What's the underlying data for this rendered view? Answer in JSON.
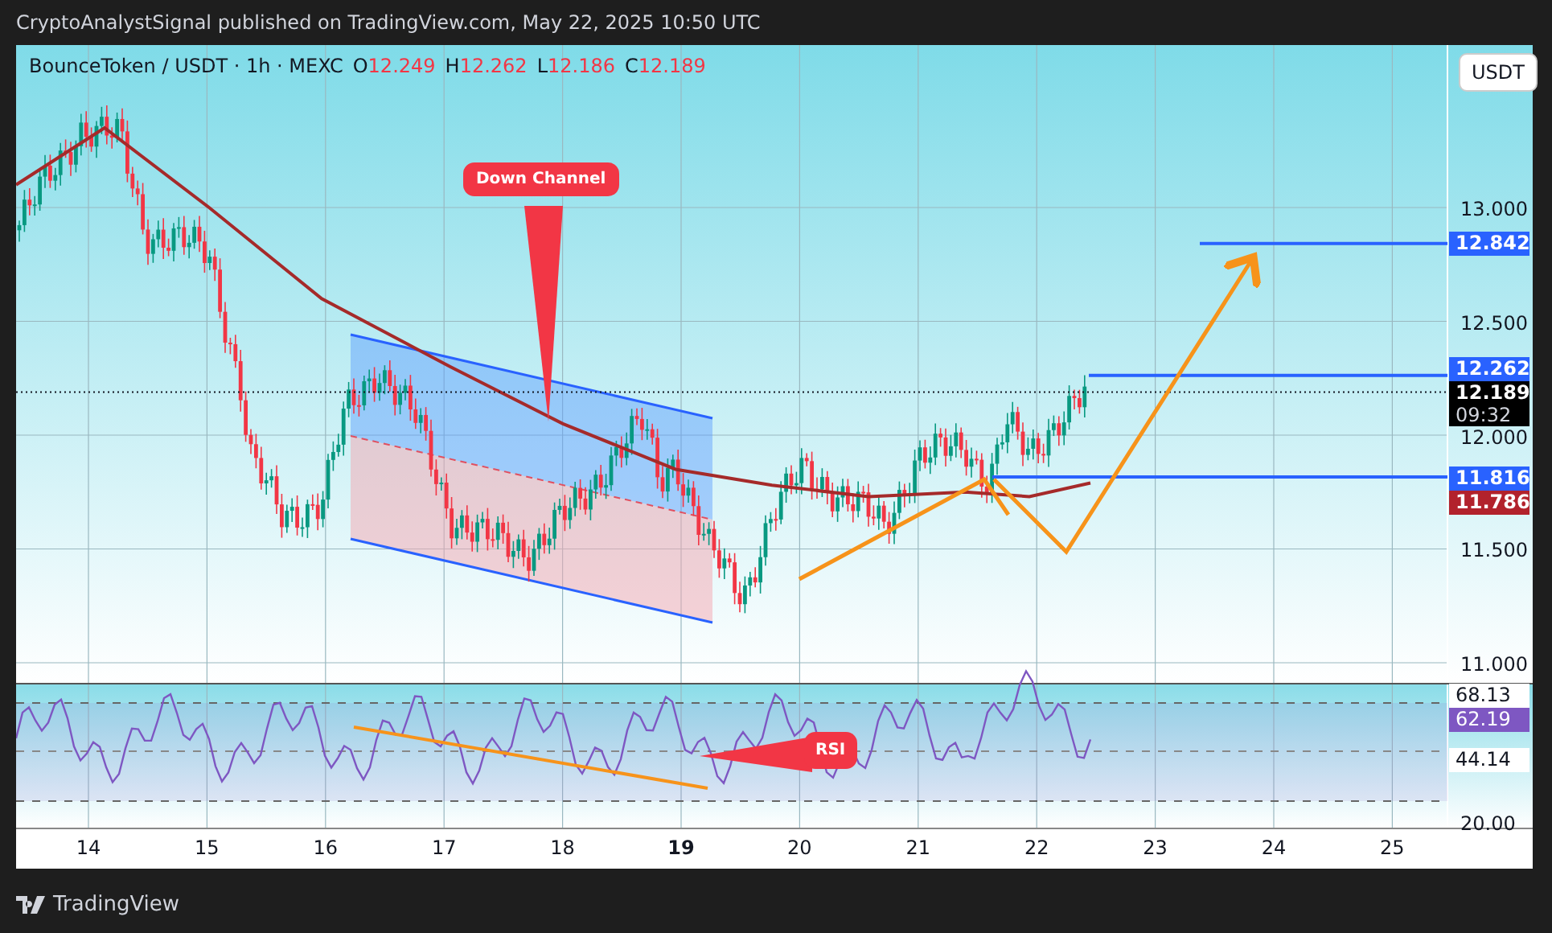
{
  "header": {
    "text": "CryptoAnalystSignal published on TradingView.com, May 22, 2025 10:50 UTC"
  },
  "symbol": {
    "name": "BounceToken / USDT · 1h · MEXC",
    "ohlc": [
      {
        "label": "O",
        "value": "12.249"
      },
      {
        "label": "H",
        "value": "12.262"
      },
      {
        "label": "L",
        "value": "12.186"
      },
      {
        "label": "C",
        "value": "12.189"
      }
    ]
  },
  "currency_button": "USDT",
  "price_axis": {
    "ticks": [
      "13.000",
      "12.500",
      "12.000",
      "11.500",
      "11.000"
    ],
    "tags": [
      {
        "value": "12.842",
        "color": "#2962ff"
      },
      {
        "value": "12.262",
        "color": "#2962ff"
      },
      {
        "value": "12.189",
        "color": "#000000",
        "countdown": "09:32"
      },
      {
        "value": "11.816",
        "color": "#2962ff"
      },
      {
        "value": "11.786",
        "color": "#b2222c"
      }
    ]
  },
  "rsi_axis": {
    "tags": [
      {
        "value": "68.13",
        "color": "#ffffff"
      },
      {
        "value": "62.19",
        "color": "#7e57c2"
      },
      {
        "value": "44.14",
        "color": "#ffffff"
      },
      {
        "value": "20.00"
      }
    ]
  },
  "time_axis": [
    {
      "label": "14",
      "emphasized": false
    },
    {
      "label": "15",
      "emphasized": false
    },
    {
      "label": "16",
      "emphasized": false
    },
    {
      "label": "17",
      "emphasized": false
    },
    {
      "label": "18",
      "emphasized": false
    },
    {
      "label": "19",
      "emphasized": true
    },
    {
      "label": "20",
      "emphasized": false
    },
    {
      "label": "21",
      "emphasized": false
    },
    {
      "label": "22",
      "emphasized": false
    },
    {
      "label": "23",
      "emphasized": false
    },
    {
      "label": "24",
      "emphasized": false
    },
    {
      "label": "25",
      "emphasized": false
    }
  ],
  "annotations": {
    "channel_callout": "Down Channel",
    "rsi_callout": "RSI"
  },
  "footer": {
    "brand": "TradingView"
  }
}
